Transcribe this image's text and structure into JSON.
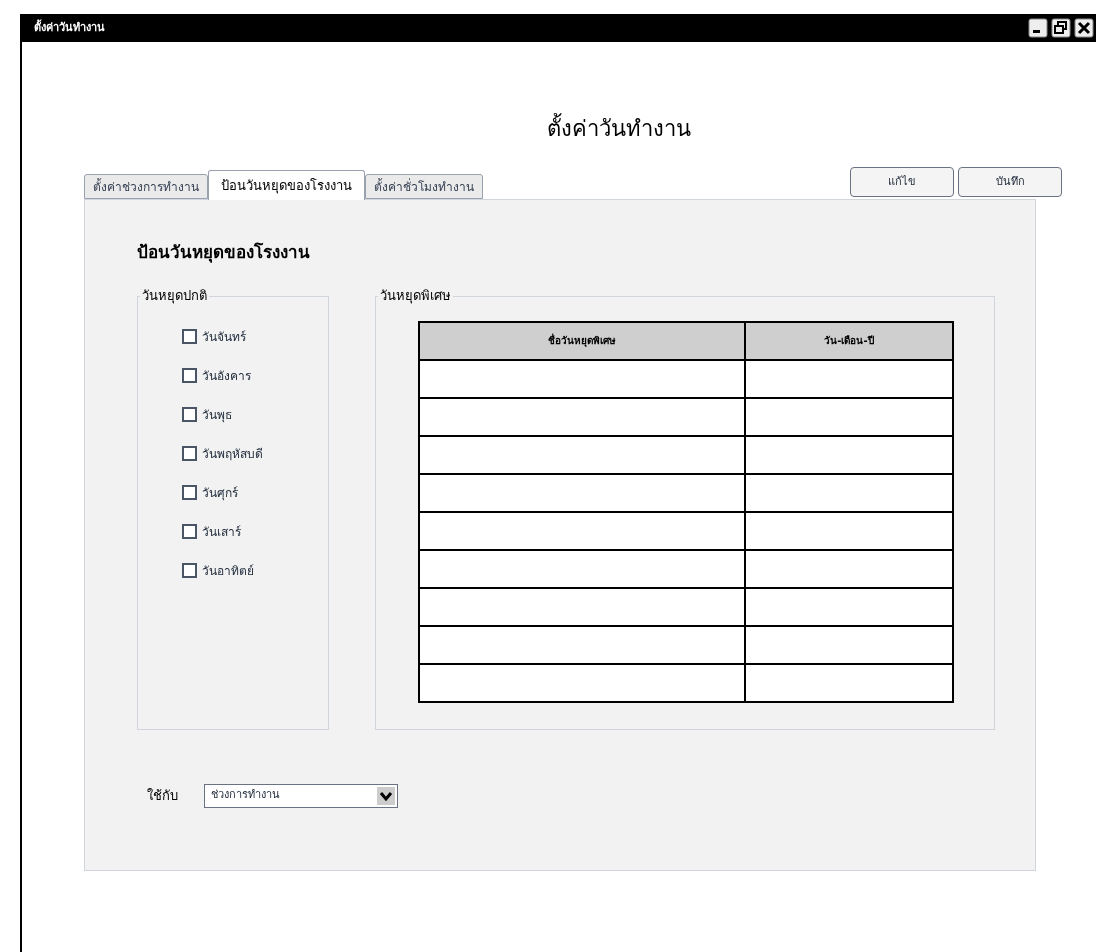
{
  "window": {
    "title": "ตั้งค่าวันทำงาน"
  },
  "heading": "ตั้งค่าวันทำงาน",
  "tabs": [
    {
      "label": "ตั้งค่าช่วงการทำงาน",
      "selected": false
    },
    {
      "label": "ป้อนวันหยุดของโรงงาน",
      "selected": true
    },
    {
      "label": "ตั้งค่าชั่วโมงทำงาน",
      "selected": false
    }
  ],
  "buttons": [
    "แก้ไข",
    "บันทึก"
  ],
  "section_title": "ป้อนวันหยุดของโรงงาน",
  "regular_holidays": {
    "title": "วันหยุดปกติ",
    "days": [
      {
        "label": "วันจันทร์",
        "checked": false
      },
      {
        "label": "วันอังคาร",
        "checked": false
      },
      {
        "label": "วันพุธ",
        "checked": false
      },
      {
        "label": "วันพฤหัสบดี",
        "checked": false
      },
      {
        "label": "วันศุกร์",
        "checked": false
      },
      {
        "label": "วันเสาร์",
        "checked": false
      },
      {
        "label": "วันอาทิตย์",
        "checked": false
      }
    ]
  },
  "special_holidays": {
    "title": "วันหยุดพิเศษ",
    "table": {
      "columns": [
        "ชื่อวันหยุดพิเศษ",
        "วัน-เดือน-ปี"
      ]
    }
  },
  "apply_to": {
    "label": "ใช้กับ",
    "value": "ช่วงการทำงาน"
  }
}
